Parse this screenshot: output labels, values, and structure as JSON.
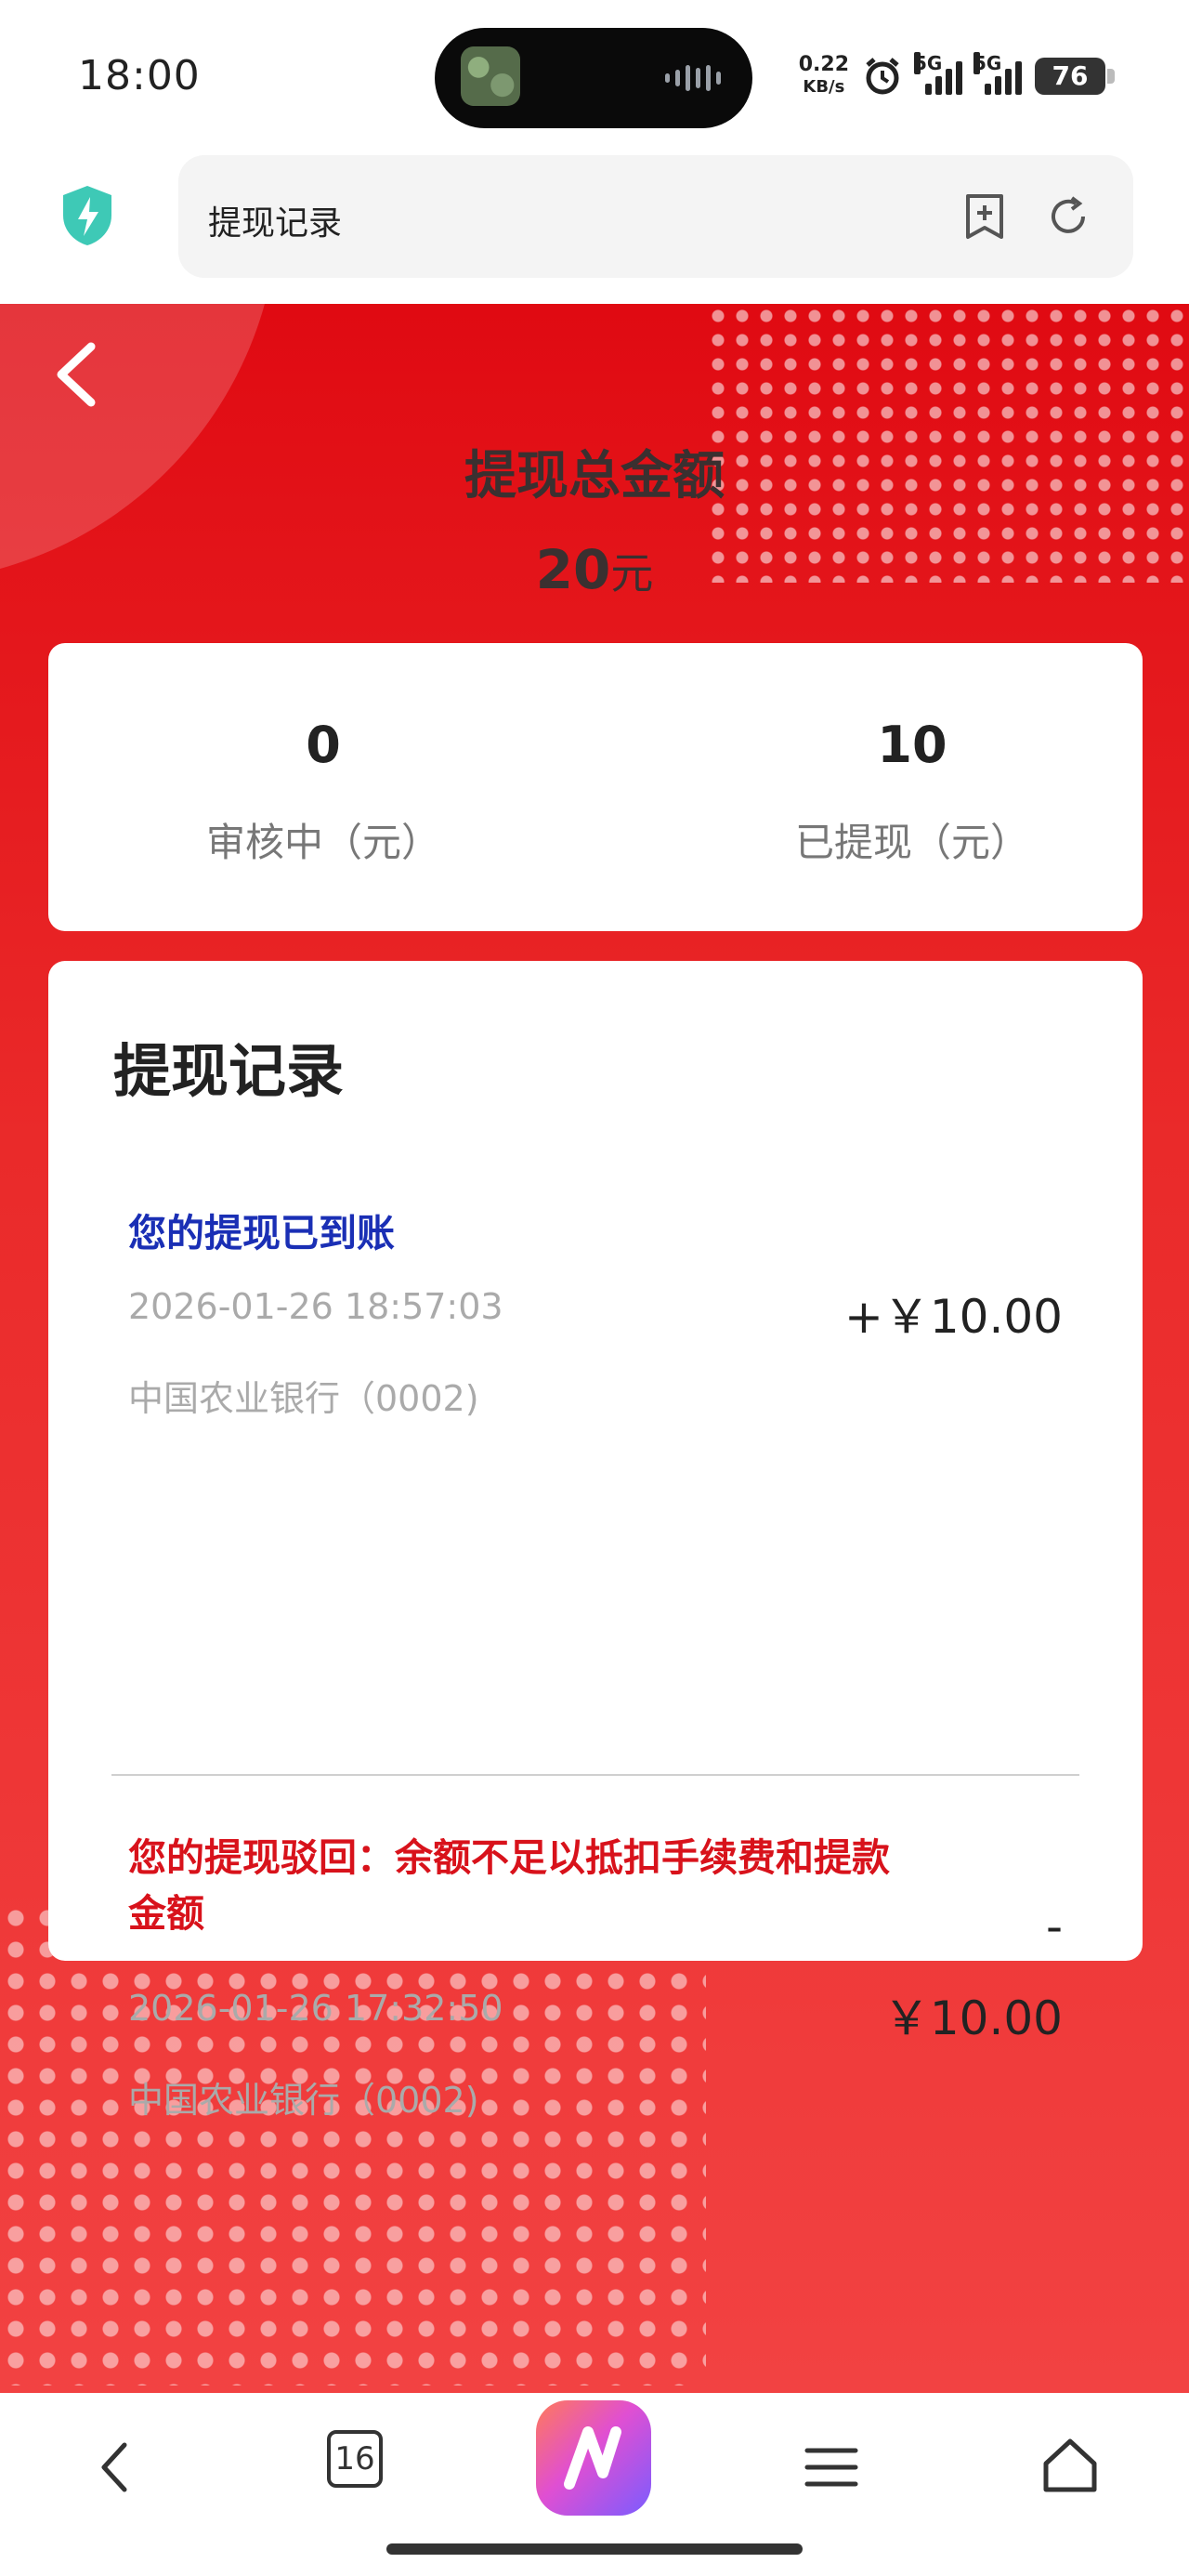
{
  "status_bar": {
    "time": "18:00",
    "network_speed": [
      "0.22",
      "KB/s"
    ],
    "signal1": "5G",
    "signal2": "5G",
    "battery": "76"
  },
  "browser": {
    "url_title": "提现记录",
    "icons": [
      "shield-icon",
      "bookmark-add-icon",
      "refresh-icon"
    ]
  },
  "summary": {
    "title": "提现总金额",
    "total_amount": "20",
    "total_unit": "元",
    "reviewing_value": "0",
    "reviewing_label": "审核中（元）",
    "withdrawn_value": "10",
    "withdrawn_label": "已提现（元）"
  },
  "records": {
    "title": "提现记录",
    "items": [
      {
        "message": "您的提现已到账",
        "time": "2026-01-26 18:57:03",
        "bank": "中国农业银行（0002)",
        "sign": "+",
        "amount": "+￥10.00",
        "color": "#1a2fb5"
      },
      {
        "message": "您的提现驳回：余额不足以抵扣手续费和提款金额",
        "time": "2026-01-26 17:32:50",
        "bank": "中国农业银行（0002)",
        "sign": "-",
        "amount": "￥10.00",
        "color": "#d8121b"
      }
    ]
  },
  "bottom_nav": {
    "tab_count": "16",
    "icons": [
      "back-icon",
      "tabs-icon",
      "ai-assistant-icon",
      "menu-icon",
      "home-icon"
    ]
  },
  "colors": {
    "page_red": "#e00a12",
    "accent_blue": "#1a2fb5",
    "accent_red": "#d8121b"
  }
}
